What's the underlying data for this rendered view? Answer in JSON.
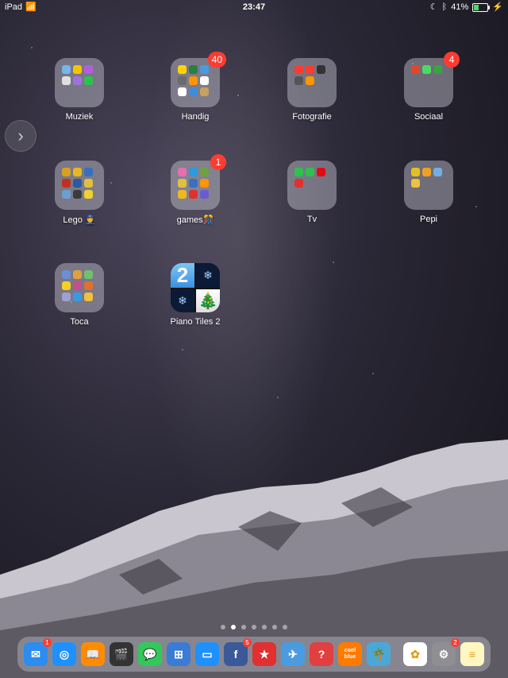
{
  "status": {
    "device": "iPad",
    "time": "23:47",
    "battery": "41%"
  },
  "folders": [
    {
      "name": "Muziek",
      "badge": "",
      "minis": [
        "#74b7e8",
        "#f5c300",
        "#b25de0",
        "#e0e0e0",
        "#a070e0",
        "#2bc24e"
      ]
    },
    {
      "name": "Handig",
      "badge": "40",
      "minis": [
        "#ffd400",
        "#2a7f40",
        "#4a9be0",
        "#6b6b6b",
        "#ff9500",
        "#fff",
        "#fff",
        "#3e8ce0",
        "#c8a060",
        "#4cd964",
        "#fff",
        "#aaaaaa"
      ]
    },
    {
      "name": "Fotografie",
      "badge": "",
      "minis": [
        "#ff3b30",
        "#ff3b30",
        "#333",
        "#555",
        "#ff9500"
      ]
    },
    {
      "name": "Sociaal",
      "badge": "4",
      "minis": [
        "#e0472b",
        "#4cd964",
        "#3aa340"
      ]
    },
    {
      "name": "Lego 👮",
      "badge": "",
      "minis": [
        "#d8a020",
        "#e6b820",
        "#3a6fc0",
        "#c03020",
        "#2a5aa0",
        "#e0c040",
        "#6aa0d0",
        "#3b3b3b",
        "#f0d030"
      ]
    },
    {
      "name": "games🎊",
      "badge": "1",
      "minis": [
        "#e66fb0",
        "#2b9ae0",
        "#70a040",
        "#e0c040",
        "#3b6fc0",
        "#ff9500",
        "#f0b820",
        "#e03030",
        "#6b5bd0",
        "#d0a070",
        "#f5d020",
        "#4cd964",
        "#ffd400",
        "#e05020"
      ]
    },
    {
      "name": "Tv",
      "badge": "",
      "minis": [
        "#2bc24e",
        "#2bc24e",
        "#e50914",
        "#e03030"
      ]
    },
    {
      "name": "Pepi",
      "badge": "",
      "minis": [
        "#e6c020",
        "#f0a020",
        "#70b0e0",
        "#f0c040"
      ]
    },
    {
      "name": "Toca",
      "badge": "",
      "minis": [
        "#6b8fd0",
        "#e0a040",
        "#70c070",
        "#f5d020",
        "#c05090",
        "#e07030",
        "#a0a0d0",
        "#3a9ae0",
        "#f0c040",
        "#d05050",
        "#50b0e0",
        "#e0d060",
        "#9a70c0",
        "#e09060",
        "#60c0a0"
      ]
    }
  ],
  "apps": [
    {
      "name": "Piano Tiles 2"
    }
  ],
  "page_count": 7,
  "page_active": 1,
  "dock": [
    {
      "name": "Mail",
      "color": "#2d8cf0",
      "glyph": "✉",
      "badge": "1"
    },
    {
      "name": "Safari",
      "color": "#1e90ff",
      "glyph": "◎",
      "badge": ""
    },
    {
      "name": "Books",
      "color": "#ff8c00",
      "glyph": "📖",
      "badge": ""
    },
    {
      "name": "Clips",
      "color": "#333",
      "glyph": "🎬",
      "badge": ""
    },
    {
      "name": "Messages",
      "color": "#34c759",
      "glyph": "💬",
      "badge": ""
    },
    {
      "name": "Keynote",
      "color": "#3a7bd5",
      "glyph": "⊞",
      "badge": ""
    },
    {
      "name": "Files",
      "color": "#1e90ff",
      "glyph": "▭",
      "badge": ""
    },
    {
      "name": "Facebook",
      "color": "#3b5998",
      "glyph": "f",
      "badge": "5"
    },
    {
      "name": "Game1",
      "color": "#e03030",
      "glyph": "★",
      "badge": ""
    },
    {
      "name": "Game2",
      "color": "#4a9be0",
      "glyph": "✈",
      "badge": ""
    },
    {
      "name": "Quiz",
      "color": "#e04040",
      "glyph": "?",
      "badge": ""
    },
    {
      "name": "Coolblue",
      "color": "#ff7a00",
      "glyph": "cool blue",
      "badge": ""
    },
    {
      "name": "Beach",
      "color": "#4aa8d8",
      "glyph": "🌴",
      "badge": ""
    },
    {
      "name": "Photos",
      "color": "#ffffff",
      "glyph": "✿",
      "badge": ""
    },
    {
      "name": "Settings",
      "color": "#8e8e93",
      "glyph": "⚙",
      "badge": "2"
    },
    {
      "name": "Notes",
      "color": "#fff7c0",
      "glyph": "≡",
      "badge": ""
    }
  ]
}
